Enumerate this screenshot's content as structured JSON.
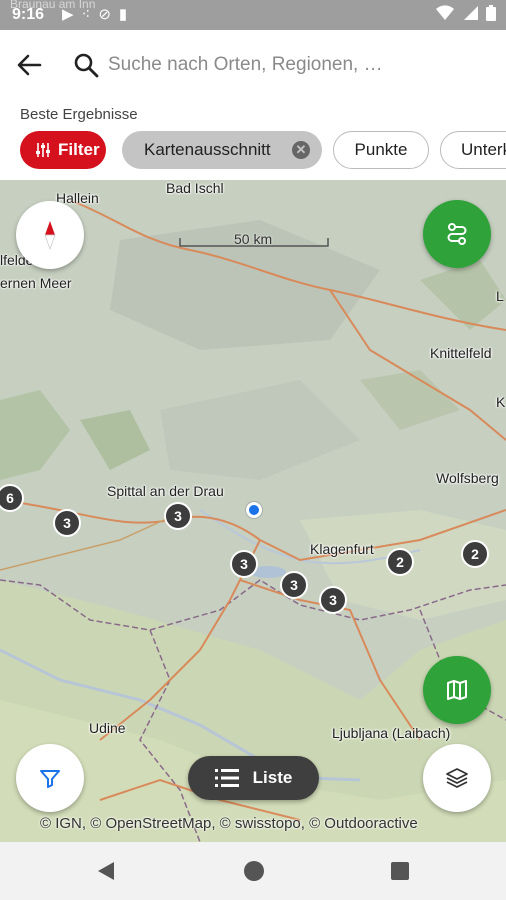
{
  "status_bar": {
    "time": "9:16",
    "peek_text": "Braunau am Inn",
    "left_icons": [
      "play-icon",
      "dots-icon",
      "no-sim-icon",
      "sd-card-icon"
    ],
    "right_icons": [
      "wifi-icon",
      "signal-icon",
      "battery-icon"
    ]
  },
  "search": {
    "placeholder": "Suche nach Orten, Regionen, …"
  },
  "results": {
    "section_label": "Beste Ergebnisse"
  },
  "chips": [
    {
      "label": "Filter",
      "state": "active",
      "color": "#d5111e"
    },
    {
      "label": "Kartenausschnitt",
      "state": "selected"
    },
    {
      "label": "Punkte",
      "state": "default"
    },
    {
      "label": "Unterk",
      "state": "default"
    }
  ],
  "map": {
    "scale_label": "50 km",
    "places": [
      {
        "name": "Hallein"
      },
      {
        "name": "Bad Ischl"
      },
      {
        "name": "lfelden"
      },
      {
        "name": "ernen Meer"
      },
      {
        "name": "Knittelfeld"
      },
      {
        "name": "Spittal an der Drau"
      },
      {
        "name": "Wolfsberg"
      },
      {
        "name": "Klagenfurt"
      },
      {
        "name": "Udine"
      },
      {
        "name": "Ljubljana (Laibach)"
      },
      {
        "name": "L"
      },
      {
        "name": "K"
      }
    ],
    "clusters": [
      "6",
      "3",
      "3",
      "3",
      "3",
      "3",
      "2",
      "2"
    ],
    "attribution": "© IGN, © OpenStreetMap, © swisstopo, © Outdooractive",
    "list_button_label": "Liste",
    "accent_green": "#2fa23a"
  },
  "nav_bar": {
    "icons": [
      "back-triangle-icon",
      "home-circle-icon",
      "recents-square-icon"
    ]
  }
}
